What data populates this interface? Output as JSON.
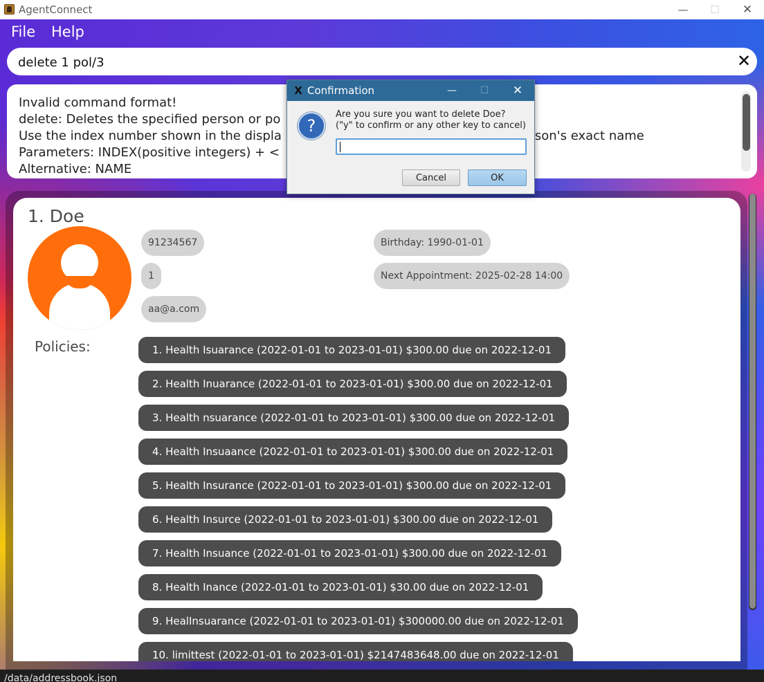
{
  "window": {
    "title": "AgentConnect",
    "minimize_icon": "—",
    "maximize_icon": "☐",
    "close_icon": "✕"
  },
  "menu": {
    "file": "File",
    "help": "Help"
  },
  "command": {
    "value": "delete 1 pol/3",
    "clear_icon": "✕"
  },
  "result": {
    "lines": [
      "Invalid command format!",
      "delete: Deletes the specified person or po",
      "Use the index number shown in the displa",
      "Parameters: INDEX(positive integers) + <",
      "Alternative: NAME"
    ],
    "right_fragment": "son's exact name"
  },
  "person": {
    "name": "1. Doe",
    "phone": "91234567",
    "address": "1",
    "email": "aa@a.com",
    "birthday": "Birthday: 1990-01-01",
    "appointment": "Next Appointment: 2025-02-28 14:00",
    "policies_label": "Policies:",
    "policies": [
      "1. Health Isuarance (2022-01-01 to 2023-01-01) $300.00 due on 2022-12-01",
      "2. Health Inuarance (2022-01-01 to 2023-01-01) $300.00 due on 2022-12-01",
      "3. Health nsuarance (2022-01-01 to 2023-01-01) $300.00 due on 2022-12-01",
      "4. Health Insuaance (2022-01-01 to 2023-01-01) $300.00 due on 2022-12-01",
      "5. Health Insurance (2022-01-01 to 2023-01-01) $300.00 due on 2022-12-01",
      "6. Health Insurce (2022-01-01 to 2023-01-01) $300.00 due on 2022-12-01",
      "7. Health Insuance (2022-01-01 to 2023-01-01) $300.00 due on 2022-12-01",
      "8. Health Inance (2022-01-01 to 2023-01-01) $30.00 due on 2022-12-01",
      "9. HealInsuarance (2022-01-01 to 2023-01-01) $300000.00 due on 2022-12-01",
      "10. limittest (2022-01-01 to 2023-01-01) $2147483648.00 due on 2022-12-01"
    ]
  },
  "status": {
    "path": "/data/addressbook.json"
  },
  "dialog": {
    "logo": "X",
    "title": "Confirmation",
    "minimize_icon": "—",
    "maximize_icon": "☐",
    "close_icon": "✕",
    "icon_glyph": "?",
    "message_line1": "Are you sure you want to delete Doe?",
    "message_line2": "(\"y\" to confirm or any other key to cancel)",
    "input_value": "",
    "cancel_label": "Cancel",
    "ok_label": "OK"
  },
  "colors": {
    "accent_orange": "#ff6e0a",
    "policy_bg": "#4d4d4d",
    "tag_bg": "#d4d4d4",
    "dialog_titlebar": "#2d6a98"
  }
}
